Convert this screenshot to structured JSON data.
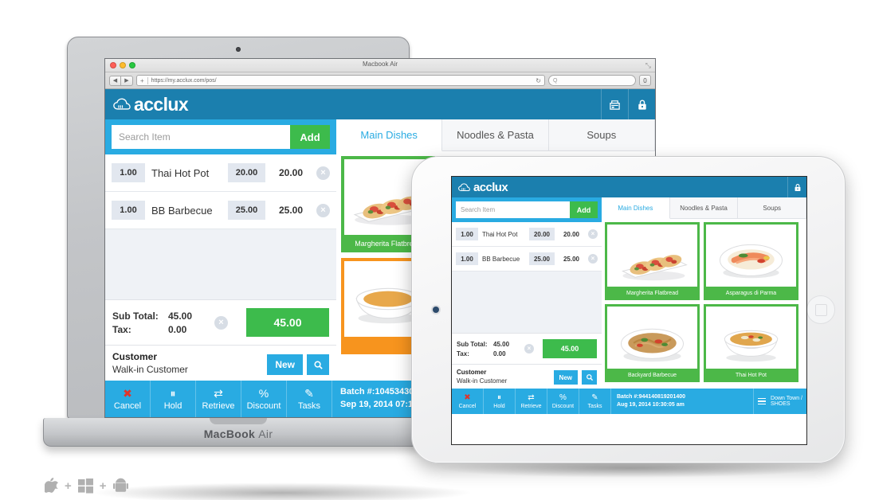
{
  "browser": {
    "window_title": "Macbook Air",
    "url": "https://my.acclux.com/pos/",
    "search_placeholder": "",
    "plus_glyph": "+",
    "back_glyph": "◀",
    "forward_glyph": "▶",
    "reload_glyph": "↻",
    "search_glyph": "Q",
    "extra_glyph": "⬜",
    "resize_glyph": "⤡"
  },
  "laptop": {
    "brand_bold": "MacBook",
    "brand_light": "Air"
  },
  "app": {
    "logo_text": "acclux",
    "header_icons": [
      {
        "name": "register-icon",
        "glyph": "🖨"
      },
      {
        "name": "lock-icon",
        "glyph": "🔒"
      }
    ],
    "search": {
      "placeholder": "Search Item",
      "value": "",
      "add_label": "Add"
    },
    "items": [
      {
        "qty": "1.00",
        "name": "Thai Hot Pot",
        "price": "20.00",
        "total": "20.00",
        "remove": "×"
      },
      {
        "qty": "1.00",
        "name": "BB Barbecue",
        "price": "25.00",
        "total": "25.00",
        "remove": "×"
      }
    ],
    "totals": {
      "subtotal_label": "Sub Total:",
      "subtotal_value": "45.00",
      "tax_label": "Tax:",
      "tax_value": "0.00",
      "clear_glyph": "×",
      "grand_total": "45.00"
    },
    "customer": {
      "title": "Customer",
      "name": "Walk-in Customer",
      "new_label": "New",
      "find_glyph": "⚲"
    },
    "tabs": [
      {
        "label": "Main Dishes",
        "active": true
      },
      {
        "label": "Noodles & Pasta",
        "active": false
      },
      {
        "label": "Soups",
        "active": false
      }
    ],
    "laptop_products": [
      {
        "name": "Margherita Flatbread",
        "color": "green",
        "image": "flatbread"
      },
      {
        "name": "Backyard Barbecue",
        "color": "green",
        "image": "noodles"
      },
      {
        "name": "",
        "color": "green",
        "image": "salmon"
      },
      {
        "name": "",
        "color": "orange",
        "image": "soup"
      },
      {
        "name": "",
        "color": "orange",
        "image": "soup"
      }
    ],
    "tablet_products": [
      {
        "name": "Margherita Flatbread",
        "color": "green",
        "image": "flatbread"
      },
      {
        "name": "Asparagus di Parma",
        "color": "green",
        "image": "salmon"
      },
      {
        "name": "Backyard Barbecue",
        "color": "green",
        "image": "noodles"
      },
      {
        "name": "Thai Hot Pot",
        "color": "green",
        "image": "soup"
      }
    ],
    "footer_buttons": [
      {
        "label": "Cancel",
        "glyph": "✖",
        "name": "cancel"
      },
      {
        "label": "Hold",
        "glyph": "⏸",
        "name": "hold"
      },
      {
        "label": "Retrieve",
        "glyph": "⇄",
        "name": "retrieve"
      },
      {
        "label": "Discount",
        "glyph": "%",
        "name": "discount"
      },
      {
        "label": "Tasks",
        "glyph": "✎",
        "name": "tasks"
      }
    ],
    "laptop_batch": {
      "batch_line": "Batch #:10453430",
      "date_line": "Sep 19, 2014 07:1"
    },
    "tablet_batch": {
      "batch_line": "Batch #:944140819201400",
      "date_line": "Aug 19, 2014 10:30:05 am"
    },
    "store": {
      "line1": "Down Town /",
      "line2": "SHOES"
    }
  },
  "platforms": [
    {
      "name": "apple-icon"
    },
    {
      "name": "plus",
      "glyph": "+"
    },
    {
      "name": "windows-icon"
    },
    {
      "name": "plus",
      "glyph": "+"
    },
    {
      "name": "android-icon"
    }
  ],
  "colors": {
    "header_blue": "#1b7fae",
    "accent_blue": "#29abe2",
    "green": "#3dbb4c",
    "card_green": "#4cb848",
    "card_orange": "#f7941e",
    "cancel_red": "#e0342b"
  }
}
